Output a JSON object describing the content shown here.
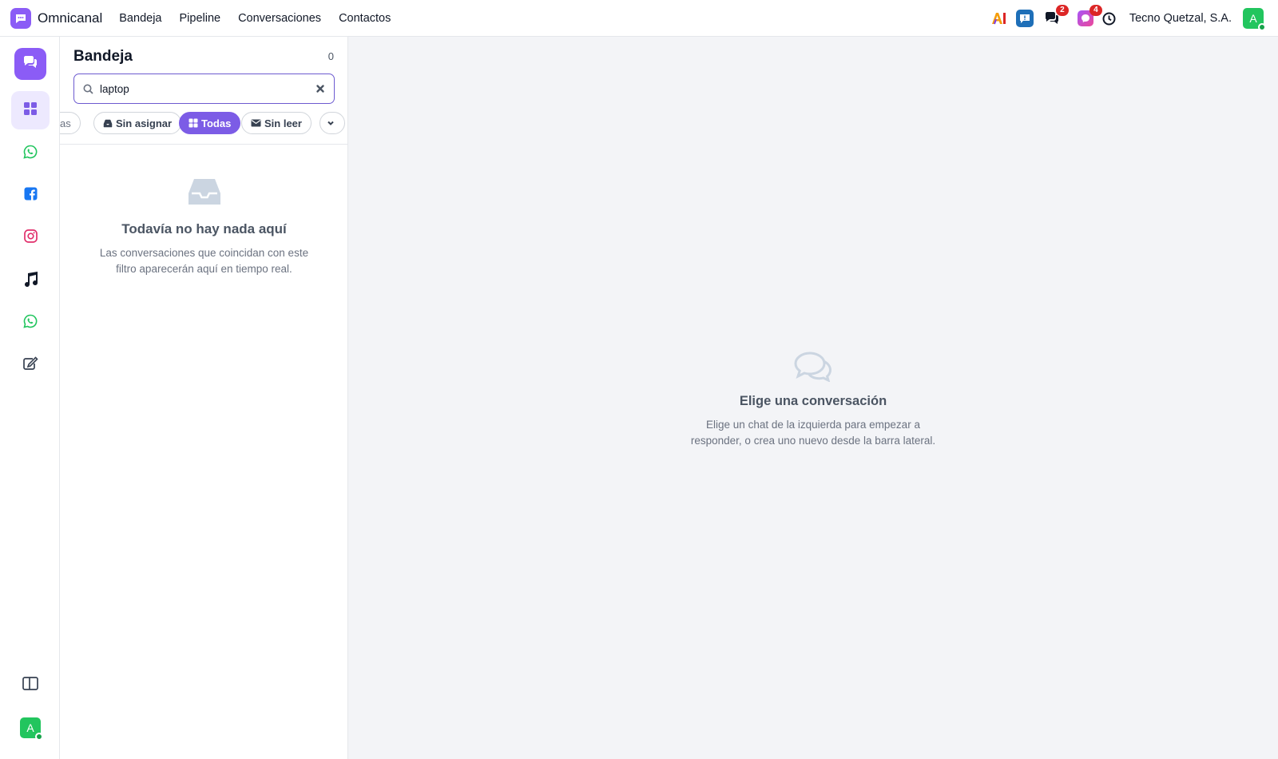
{
  "app": {
    "name": "Omnicanal"
  },
  "nav": [
    "Bandeja",
    "Pipeline",
    "Conversaciones",
    "Contactos"
  ],
  "topbar": {
    "badges": {
      "chats": "2",
      "messenger": "4"
    },
    "company": "Tecno Quetzal, S.A.",
    "avatar_initial": "A"
  },
  "rail": {
    "items": [
      "chat-icon",
      "grid-icon",
      "whatsapp-icon",
      "facebook-icon",
      "instagram-icon",
      "tiktok-icon",
      "whatsapp-icon",
      "edit-icon"
    ],
    "bottom": [
      "layout-icon",
      "avatar"
    ],
    "avatar_initial": "A"
  },
  "panel": {
    "title": "Bandeja",
    "count": "0",
    "search_value": "laptop",
    "filters": [
      "as",
      "Sin asignar",
      "Todas",
      "Sin leer"
    ],
    "active_filter": "Todas",
    "empty_title": "Todavía no hay nada aquí",
    "empty_desc": "Las conversaciones que coincidan con este filtro aparecerán aquí en tiempo real."
  },
  "main": {
    "empty_title": "Elige una conversación",
    "empty_desc": "Elige un chat de la izquierda para empezar a responder, o crea uno nuevo desde la barra lateral."
  },
  "colors": {
    "accent": "#7c5ce6",
    "brand": "#8b5cf6",
    "online": "#22c55e",
    "badge": "#dc2626"
  }
}
